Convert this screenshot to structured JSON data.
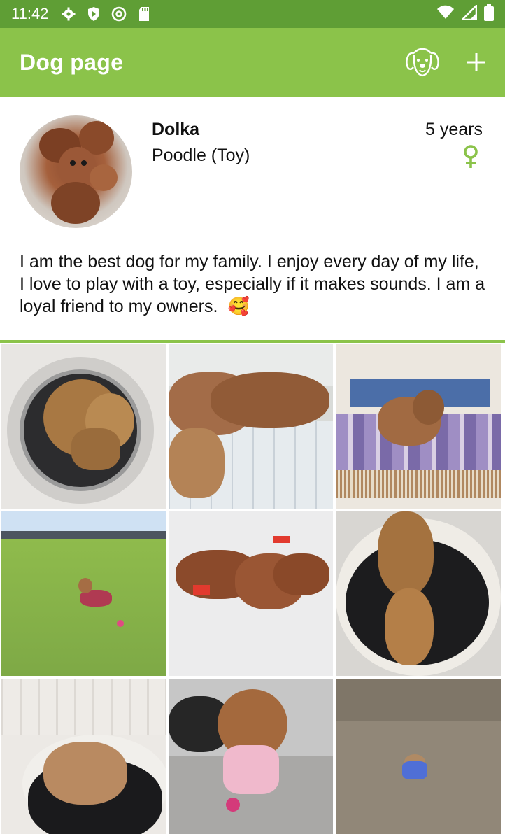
{
  "status_bar": {
    "time": "11:42",
    "icons": [
      "gear-icon",
      "shield-icon",
      "at-sign-icon",
      "sd-card-icon",
      "wifi-icon",
      "signal-icon",
      "battery-icon"
    ]
  },
  "app_bar": {
    "title": "Dog page",
    "actions": [
      "dog-face-icon",
      "plus-icon"
    ],
    "color": "#8bc34a"
  },
  "profile": {
    "name": "Dolka",
    "breed": "Poodle (Toy)",
    "age": "5 years",
    "sex_icon": "female-symbol-icon",
    "bio": "I am the best dog for my family. I enjoy every day of my life, I love to play with a toy, especially if it makes sounds. I am a loyal friend to my owners.",
    "bio_emoji": "🥰"
  },
  "gallery": {
    "photos": [
      "photo-dog-in-washing-machine",
      "photo-dog-under-blanket",
      "photo-dog-on-plaid",
      "photo-dog-on-lawn",
      "photo-dog-on-white-sheet",
      "photo-dog-in-bed-from-above",
      "photo-dog-in-round-bed",
      "photo-dog-in-pink-jacket",
      "photo-dog-on-ground-blue-jacket"
    ]
  }
}
